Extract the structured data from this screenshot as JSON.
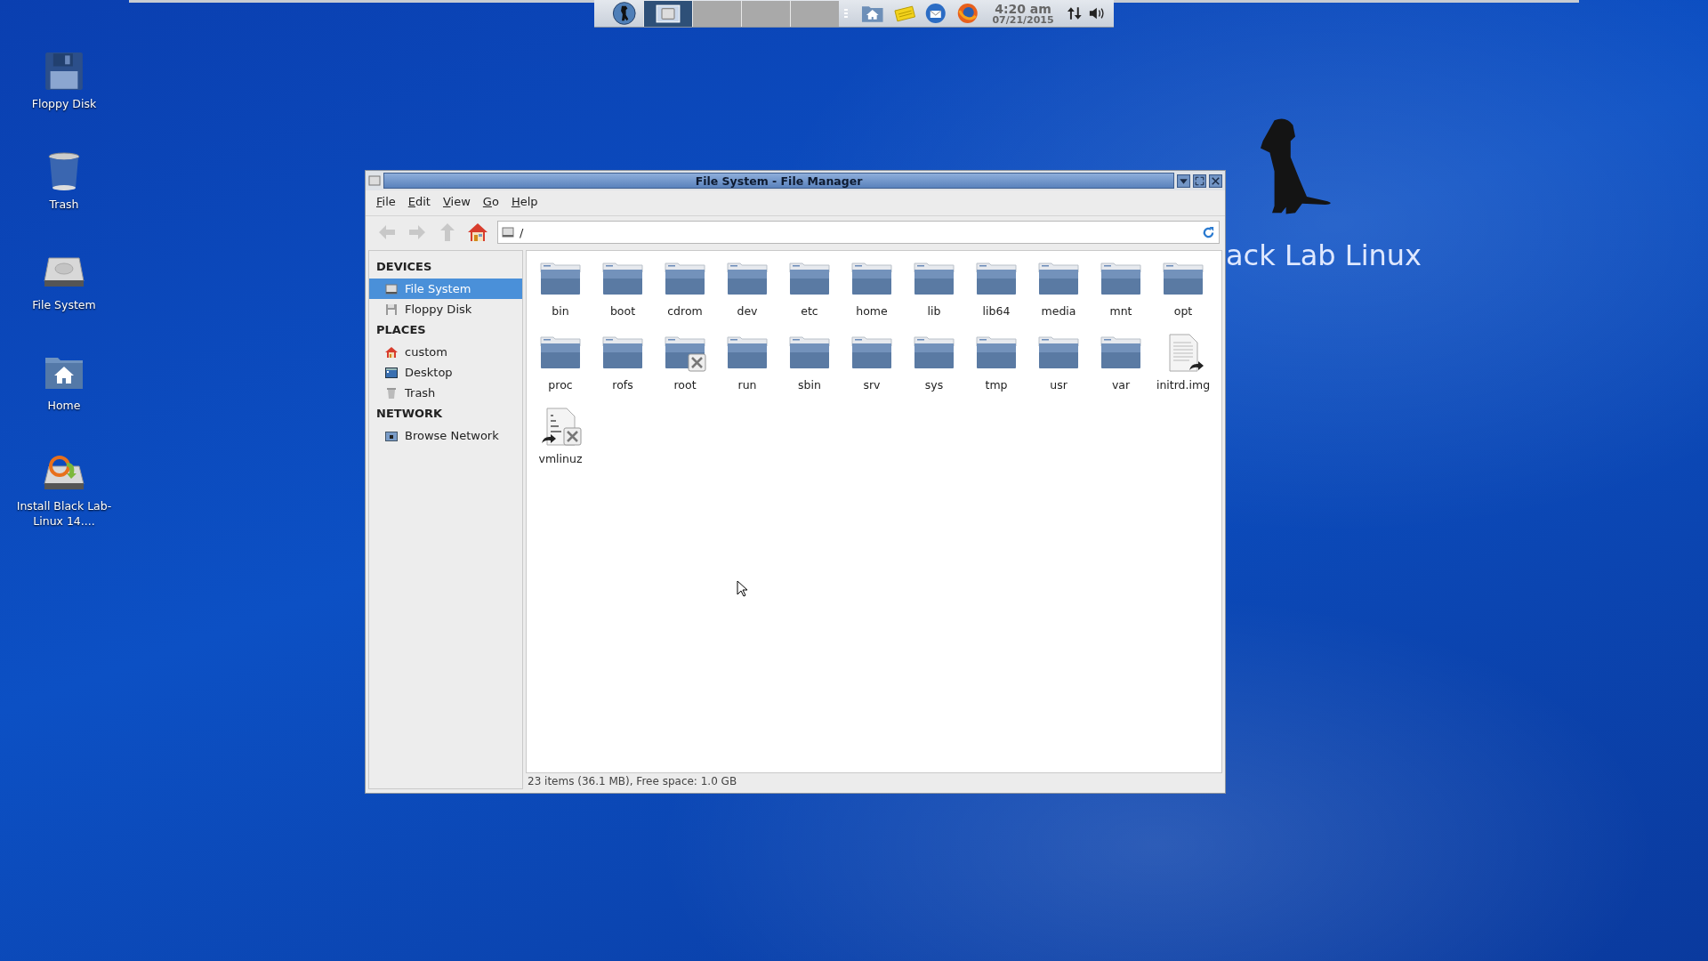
{
  "top_panel": {
    "tasks": [
      {
        "kind": "app",
        "selected": true
      },
      {
        "kind": "blank",
        "selected": false
      },
      {
        "kind": "blank",
        "selected": false
      },
      {
        "kind": "blank",
        "selected": false
      }
    ],
    "clock": {
      "time": "4:20 am",
      "date": "07/21/2015"
    }
  },
  "desktop_icons": [
    {
      "label": "Floppy Disk",
      "kind": "floppy"
    },
    {
      "label": "Trash",
      "kind": "trash"
    },
    {
      "label": "File System",
      "kind": "drive"
    },
    {
      "label": "Home",
      "kind": "home"
    },
    {
      "label": "Install Black Lab-Linux 14....",
      "kind": "installer"
    }
  ],
  "wallpaper_text": "ack Lab Linux",
  "window": {
    "title": "File System - File Manager",
    "menu": [
      "File",
      "Edit",
      "View",
      "Go",
      "Help"
    ],
    "toolbar": [
      {
        "kind": "back",
        "disabled": true
      },
      {
        "kind": "forward",
        "disabled": true
      },
      {
        "kind": "up",
        "disabled": true
      },
      {
        "kind": "home",
        "disabled": false
      }
    ],
    "location": "/",
    "sidebar": [
      {
        "heading": "DEVICES",
        "items": [
          {
            "label": "File System",
            "kind": "drive",
            "selected": true
          },
          {
            "label": "Floppy Disk",
            "kind": "floppy",
            "selected": false
          }
        ]
      },
      {
        "heading": "PLACES",
        "items": [
          {
            "label": "custom",
            "kind": "home",
            "selected": false
          },
          {
            "label": "Desktop",
            "kind": "desktop",
            "selected": false
          },
          {
            "label": "Trash",
            "kind": "trash",
            "selected": false
          }
        ]
      },
      {
        "heading": "NETWORK",
        "items": [
          {
            "label": "Browse Network",
            "kind": "network",
            "selected": false
          }
        ]
      }
    ],
    "files": [
      {
        "name": "bin",
        "kind": "folder",
        "symlink": false,
        "unreadable": false
      },
      {
        "name": "boot",
        "kind": "folder",
        "symlink": false,
        "unreadable": false
      },
      {
        "name": "cdrom",
        "kind": "folder",
        "symlink": false,
        "unreadable": false
      },
      {
        "name": "dev",
        "kind": "folder",
        "symlink": false,
        "unreadable": false
      },
      {
        "name": "etc",
        "kind": "folder",
        "symlink": false,
        "unreadable": false
      },
      {
        "name": "home",
        "kind": "folder",
        "symlink": false,
        "unreadable": false
      },
      {
        "name": "lib",
        "kind": "folder",
        "symlink": false,
        "unreadable": false
      },
      {
        "name": "lib64",
        "kind": "folder",
        "symlink": false,
        "unreadable": false
      },
      {
        "name": "media",
        "kind": "folder",
        "symlink": false,
        "unreadable": false
      },
      {
        "name": "mnt",
        "kind": "folder",
        "symlink": false,
        "unreadable": false
      },
      {
        "name": "opt",
        "kind": "folder",
        "symlink": false,
        "unreadable": false
      },
      {
        "name": "proc",
        "kind": "folder",
        "symlink": false,
        "unreadable": false
      },
      {
        "name": "rofs",
        "kind": "folder",
        "symlink": false,
        "unreadable": false
      },
      {
        "name": "root",
        "kind": "folder",
        "symlink": false,
        "unreadable": true
      },
      {
        "name": "run",
        "kind": "folder",
        "symlink": false,
        "unreadable": false
      },
      {
        "name": "sbin",
        "kind": "folder",
        "symlink": false,
        "unreadable": false
      },
      {
        "name": "srv",
        "kind": "folder",
        "symlink": false,
        "unreadable": false
      },
      {
        "name": "sys",
        "kind": "folder",
        "symlink": false,
        "unreadable": false
      },
      {
        "name": "tmp",
        "kind": "folder",
        "symlink": false,
        "unreadable": false
      },
      {
        "name": "usr",
        "kind": "folder",
        "symlink": false,
        "unreadable": false
      },
      {
        "name": "var",
        "kind": "folder",
        "symlink": false,
        "unreadable": false
      },
      {
        "name": "initrd.img",
        "kind": "document",
        "symlink": true,
        "unreadable": false
      },
      {
        "name": "vmlinuz",
        "kind": "binary",
        "symlink": true,
        "unreadable": true
      }
    ],
    "status": "23 items (36.1 MB), Free space: 1.0 GB"
  }
}
